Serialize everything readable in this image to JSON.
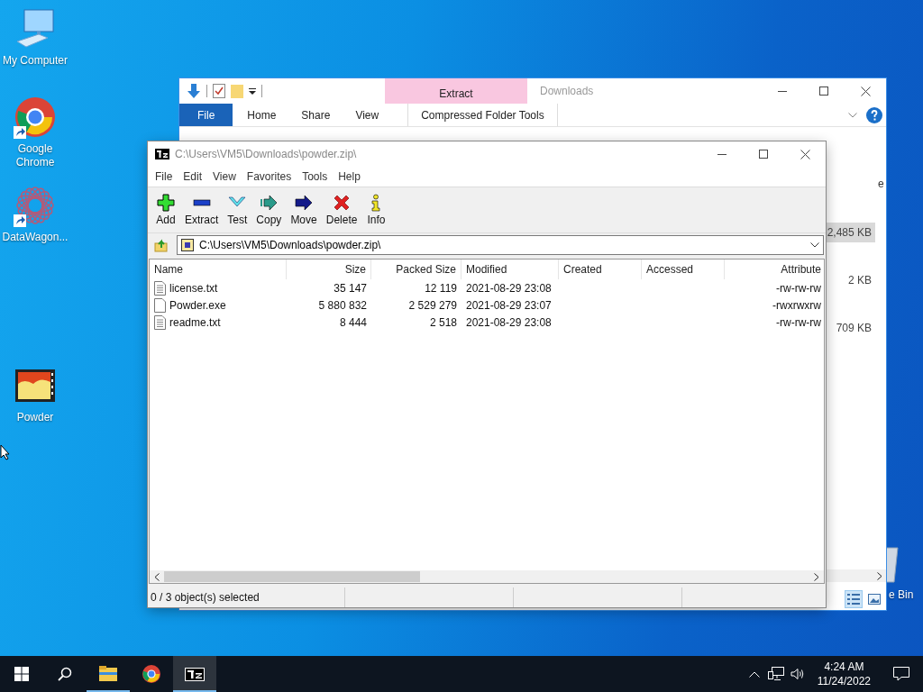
{
  "desktop_icons": [
    {
      "kind": "computer",
      "label": "My Computer",
      "shortcut": false
    },
    {
      "kind": "chrome",
      "label": "Google Chrome",
      "shortcut": true
    },
    {
      "kind": "datawagon",
      "label": "DataWagon...",
      "shortcut": true
    },
    {
      "kind": "video",
      "label": "Powder",
      "shortcut": false
    }
  ],
  "recycle_bin": {
    "label": "e Bin"
  },
  "explorer": {
    "title": "Downloads",
    "contextual_tab": "Extract",
    "ribbon_tabs": [
      {
        "kind": "file",
        "label": "File",
        "selected": false
      },
      {
        "kind": "tab",
        "label": "Home",
        "selected": false
      },
      {
        "kind": "tab",
        "label": "Share",
        "selected": false
      },
      {
        "kind": "tab",
        "label": "View",
        "selected": false
      },
      {
        "kind": "context",
        "label": "Compressed Folder Tools",
        "selected": false
      }
    ],
    "column_fragment": "e",
    "sizes": [
      {
        "text": "2,485 KB",
        "selected": true
      },
      {
        "text": "2 KB",
        "selected": false
      },
      {
        "text": "709 KB",
        "selected": false
      }
    ]
  },
  "sevenzip": {
    "title": "C:\\Users\\VM5\\Downloads\\powder.zip\\",
    "menu": [
      "File",
      "Edit",
      "View",
      "Favorites",
      "Tools",
      "Help"
    ],
    "toolbar": [
      {
        "kind": "add",
        "label": "Add"
      },
      {
        "kind": "extract",
        "label": "Extract"
      },
      {
        "kind": "test",
        "label": "Test"
      },
      {
        "kind": "copy",
        "label": "Copy"
      },
      {
        "kind": "move",
        "label": "Move"
      },
      {
        "kind": "delete",
        "label": "Delete"
      },
      {
        "kind": "info",
        "label": "Info"
      }
    ],
    "address": "C:\\Users\\VM5\\Downloads\\powder.zip\\",
    "columns": [
      "Name",
      "Size",
      "Packed Size",
      "Modified",
      "Created",
      "Accessed",
      "Attribute"
    ],
    "rows": [
      {
        "kind": "text",
        "name": "license.txt",
        "size": "35 147",
        "packed": "12 119",
        "modified": "2021-08-29 23:08",
        "attributes": "-rw-rw-rw"
      },
      {
        "kind": "exe",
        "name": "Powder.exe",
        "size": "5 880 832",
        "packed": "2 529 279",
        "modified": "2021-08-29 23:07",
        "attributes": "-rwxrwxrw"
      },
      {
        "kind": "text",
        "name": "readme.txt",
        "size": "8 444",
        "packed": "2 518",
        "modified": "2021-08-29 23:08",
        "attributes": "-rw-rw-rw"
      }
    ],
    "status": "0 / 3 object(s) selected"
  },
  "taskbar": {
    "apps": [
      {
        "kind": "explorer",
        "running": true,
        "active": false
      },
      {
        "kind": "chrome",
        "running": false,
        "active": false
      },
      {
        "kind": "sevenzip",
        "running": true,
        "active": true
      }
    ],
    "time": "4:24 AM",
    "date": "11/24/2022"
  }
}
